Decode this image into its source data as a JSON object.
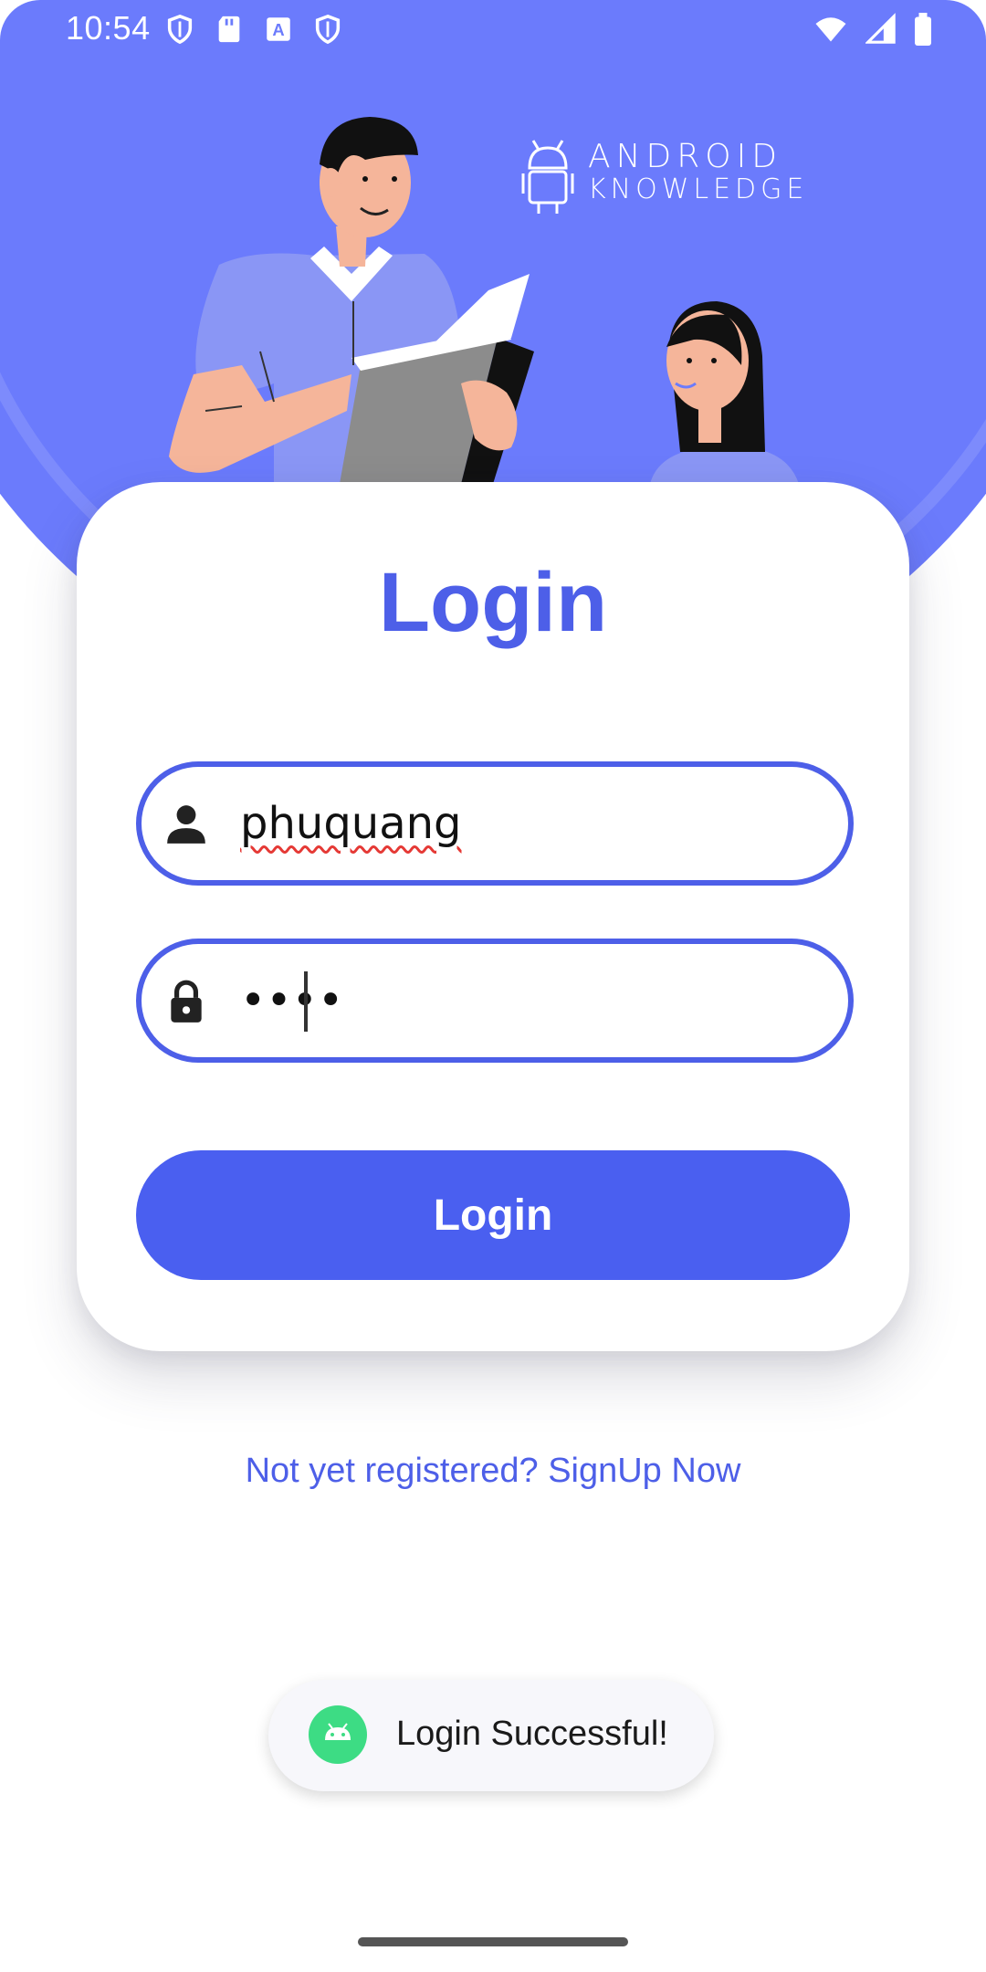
{
  "status_bar": {
    "time": "10:54",
    "left_icons": [
      "shield-icon",
      "sd-card-icon",
      "font-a-icon",
      "shield-icon"
    ],
    "right_icons": [
      "wifi-icon",
      "signal-icon",
      "battery-icon"
    ]
  },
  "brand": {
    "line1": "ANDROID",
    "line2": "KNOWLEDGE"
  },
  "login_card": {
    "title": "Login",
    "username_value": "phuquang",
    "password_value": "••••",
    "button_label": "Login"
  },
  "signup_link": "Not yet registered? SignUp Now",
  "toast": {
    "message": "Login Successful!"
  },
  "colors": {
    "accent": "#4d5fe8",
    "hero_bg": "#6b7bfc",
    "button": "#4a5ff0"
  }
}
